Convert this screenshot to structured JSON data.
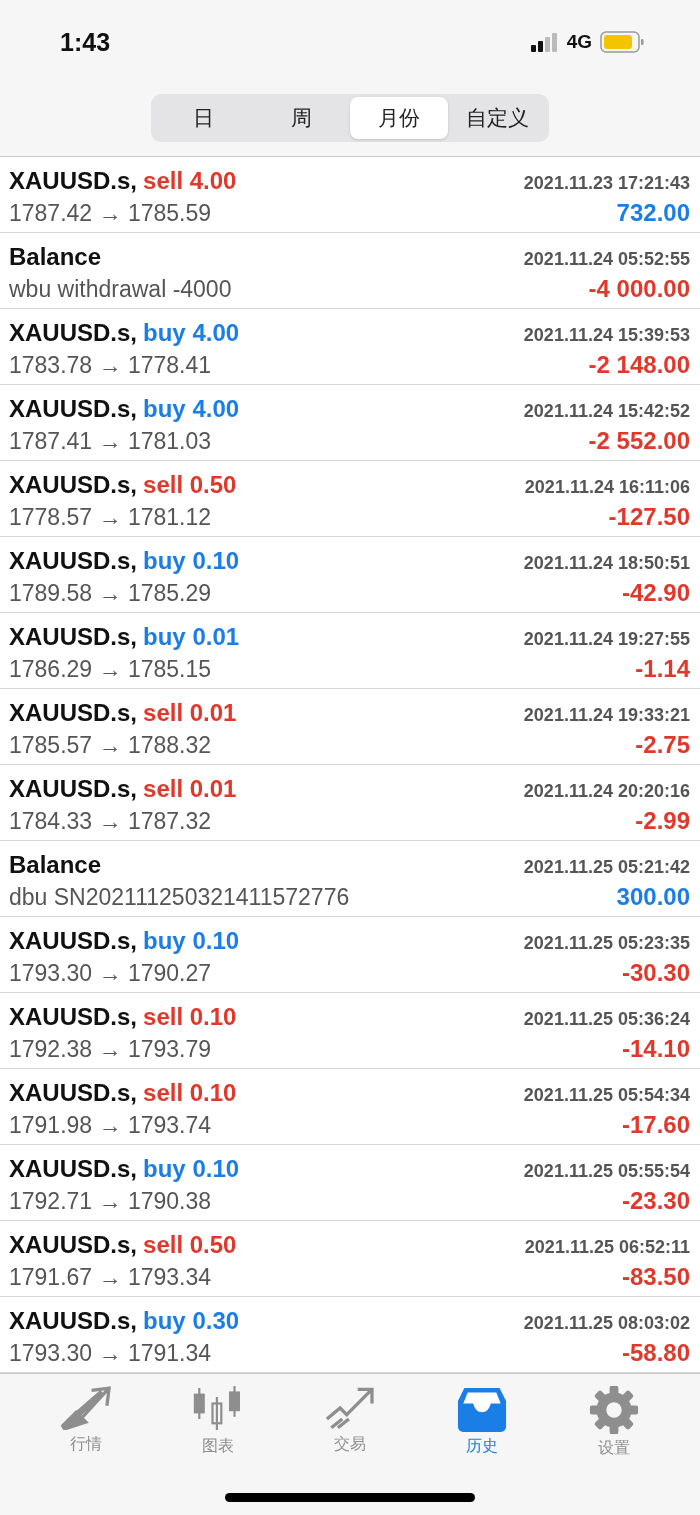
{
  "status_bar": {
    "time": "1:43",
    "network": "4G"
  },
  "period_tabs": [
    {
      "label": "日",
      "selected": false
    },
    {
      "label": "周",
      "selected": false
    },
    {
      "label": "月份",
      "selected": true
    },
    {
      "label": "自定义",
      "selected": false
    }
  ],
  "history": [
    {
      "kind": "sell",
      "symbol": "XAUUSD.s,",
      "side": "sell",
      "volume": "4.00",
      "time": "2021.11.23 17:21:43",
      "detail": "1787.42 → 1785.59",
      "profit": "732.00",
      "loss": false
    },
    {
      "kind": "balance",
      "symbol": "Balance",
      "time": "2021.11.24 05:52:55",
      "detail": "wbu withdrawal -4000",
      "profit": "-4 000.00",
      "loss": true
    },
    {
      "kind": "buy",
      "symbol": "XAUUSD.s,",
      "side": "buy",
      "volume": "4.00",
      "time": "2021.11.24 15:39:53",
      "detail": "1783.78 → 1778.41",
      "profit": "-2 148.00",
      "loss": true
    },
    {
      "kind": "buy",
      "symbol": "XAUUSD.s,",
      "side": "buy",
      "volume": "4.00",
      "time": "2021.11.24 15:42:52",
      "detail": "1787.41 → 1781.03",
      "profit": "-2 552.00",
      "loss": true
    },
    {
      "kind": "sell",
      "symbol": "XAUUSD.s,",
      "side": "sell",
      "volume": "0.50",
      "time": "2021.11.24 16:11:06",
      "detail": "1778.57 → 1781.12",
      "profit": "-127.50",
      "loss": true
    },
    {
      "kind": "buy",
      "symbol": "XAUUSD.s,",
      "side": "buy",
      "volume": "0.10",
      "time": "2021.11.24 18:50:51",
      "detail": "1789.58 → 1785.29",
      "profit": "-42.90",
      "loss": true
    },
    {
      "kind": "buy",
      "symbol": "XAUUSD.s,",
      "side": "buy",
      "volume": "0.01",
      "time": "2021.11.24 19:27:55",
      "detail": "1786.29 → 1785.15",
      "profit": "-1.14",
      "loss": true
    },
    {
      "kind": "sell",
      "symbol": "XAUUSD.s,",
      "side": "sell",
      "volume": "0.01",
      "time": "2021.11.24 19:33:21",
      "detail": "1785.57 → 1788.32",
      "profit": "-2.75",
      "loss": true
    },
    {
      "kind": "sell",
      "symbol": "XAUUSD.s,",
      "side": "sell",
      "volume": "0.01",
      "time": "2021.11.24 20:20:16",
      "detail": "1784.33 → 1787.32",
      "profit": "-2.99",
      "loss": true
    },
    {
      "kind": "balance",
      "symbol": "Balance",
      "time": "2021.11.25 05:21:42",
      "detail": "dbu SN20211125032141157277​6",
      "profit": "300.00",
      "loss": false
    },
    {
      "kind": "buy",
      "symbol": "XAUUSD.s,",
      "side": "buy",
      "volume": "0.10",
      "time": "2021.11.25 05:23:35",
      "detail": "1793.30 → 1790.27",
      "profit": "-30.30",
      "loss": true
    },
    {
      "kind": "sell",
      "symbol": "XAUUSD.s,",
      "side": "sell",
      "volume": "0.10",
      "time": "2021.11.25 05:36:24",
      "detail": "1792.38 → 1793.79",
      "profit": "-14.10",
      "loss": true
    },
    {
      "kind": "sell",
      "symbol": "XAUUSD.s,",
      "side": "sell",
      "volume": "0.10",
      "time": "2021.11.25 05:54:34",
      "detail": "1791.98 → 1793.74",
      "profit": "-17.60",
      "loss": true
    },
    {
      "kind": "buy",
      "symbol": "XAUUSD.s,",
      "side": "buy",
      "volume": "0.10",
      "time": "2021.11.25 05:55:54",
      "detail": "1792.71 → 1790.38",
      "profit": "-23.30",
      "loss": true
    },
    {
      "kind": "sell",
      "symbol": "XAUUSD.s,",
      "side": "sell",
      "volume": "0.50",
      "time": "2021.11.25 06:52:11",
      "detail": "1791.67 → 1793.34",
      "profit": "-83.50",
      "loss": true
    },
    {
      "kind": "buy",
      "symbol": "XAUUSD.s,",
      "side": "buy",
      "volume": "0.30",
      "time": "2021.11.25 08:03:02",
      "detail": "1793.30 → 1791.34",
      "profit": "-58.80",
      "loss": true
    }
  ],
  "bottom_tabs": [
    {
      "label": "行情",
      "kind": "quotes",
      "selected": false
    },
    {
      "label": "图表",
      "kind": "chart",
      "selected": false
    },
    {
      "label": "交易",
      "kind": "trade",
      "selected": false
    },
    {
      "label": "历史",
      "kind": "history",
      "selected": true
    },
    {
      "label": "设置",
      "kind": "settings",
      "selected": false
    }
  ]
}
